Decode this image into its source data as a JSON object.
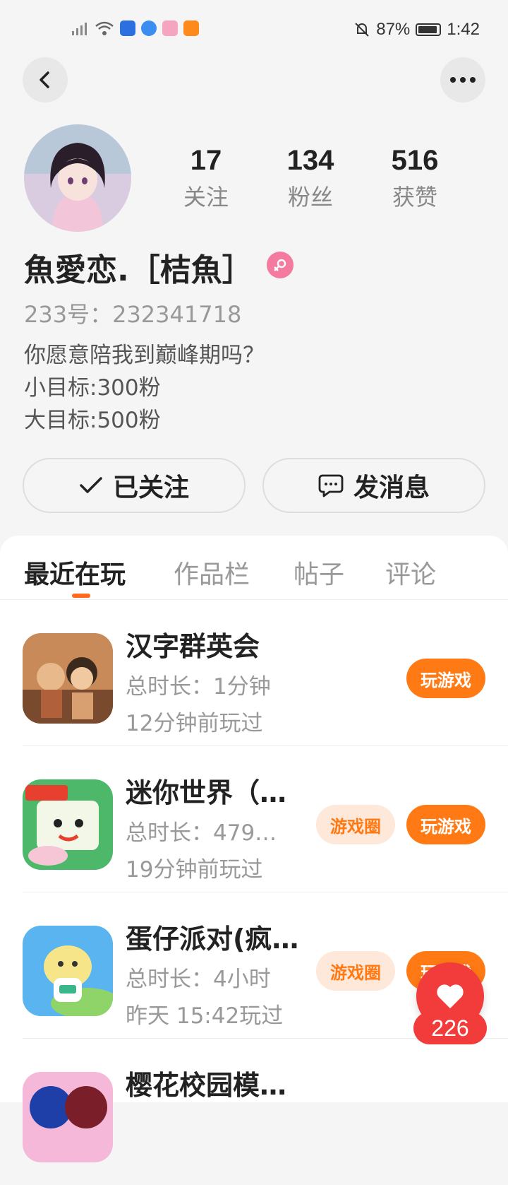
{
  "status_bar": {
    "battery": "87%",
    "time": "1:42"
  },
  "profile": {
    "following": "17",
    "following_label": "关注",
    "followers": "134",
    "followers_label": "粉丝",
    "likes": "516",
    "likes_label": "获赞",
    "name": "魚愛恋.［桔魚］",
    "uid": "233号：232341718",
    "bio": [
      "你愿意陪我到巅峰期吗？",
      "小目标:300粉",
      "大目标:500粉"
    ]
  },
  "actions": {
    "follow_label": "已关注",
    "message_label": "发消息"
  },
  "tabs": [
    "最近在玩",
    "作品栏",
    "帖子",
    "评论"
  ],
  "games": [
    {
      "title": "汉字群英会",
      "duration": "总时长：1分钟",
      "last_played": "12分钟前玩过",
      "circle_label": "",
      "play_label": "玩游戏"
    },
    {
      "title": "迷你世界（…",
      "duration": "总时长：479…",
      "last_played": "19分钟前玩过",
      "circle_label": "游戏圈",
      "play_label": "玩游戏"
    },
    {
      "title": "蛋仔派对(疯…",
      "duration": "总时长：4小时",
      "last_played": "昨天 15:42玩过",
      "circle_label": "游戏圈",
      "play_label": "玩游戏"
    },
    {
      "title": "樱花校园模…",
      "duration": "",
      "last_played": "",
      "circle_label": "",
      "play_label": ""
    }
  ],
  "like_fab": {
    "count": "226",
    "color": "#f23c3c"
  },
  "colors": {
    "accent": "#ff7a14",
    "pink": "#f47aa0"
  }
}
